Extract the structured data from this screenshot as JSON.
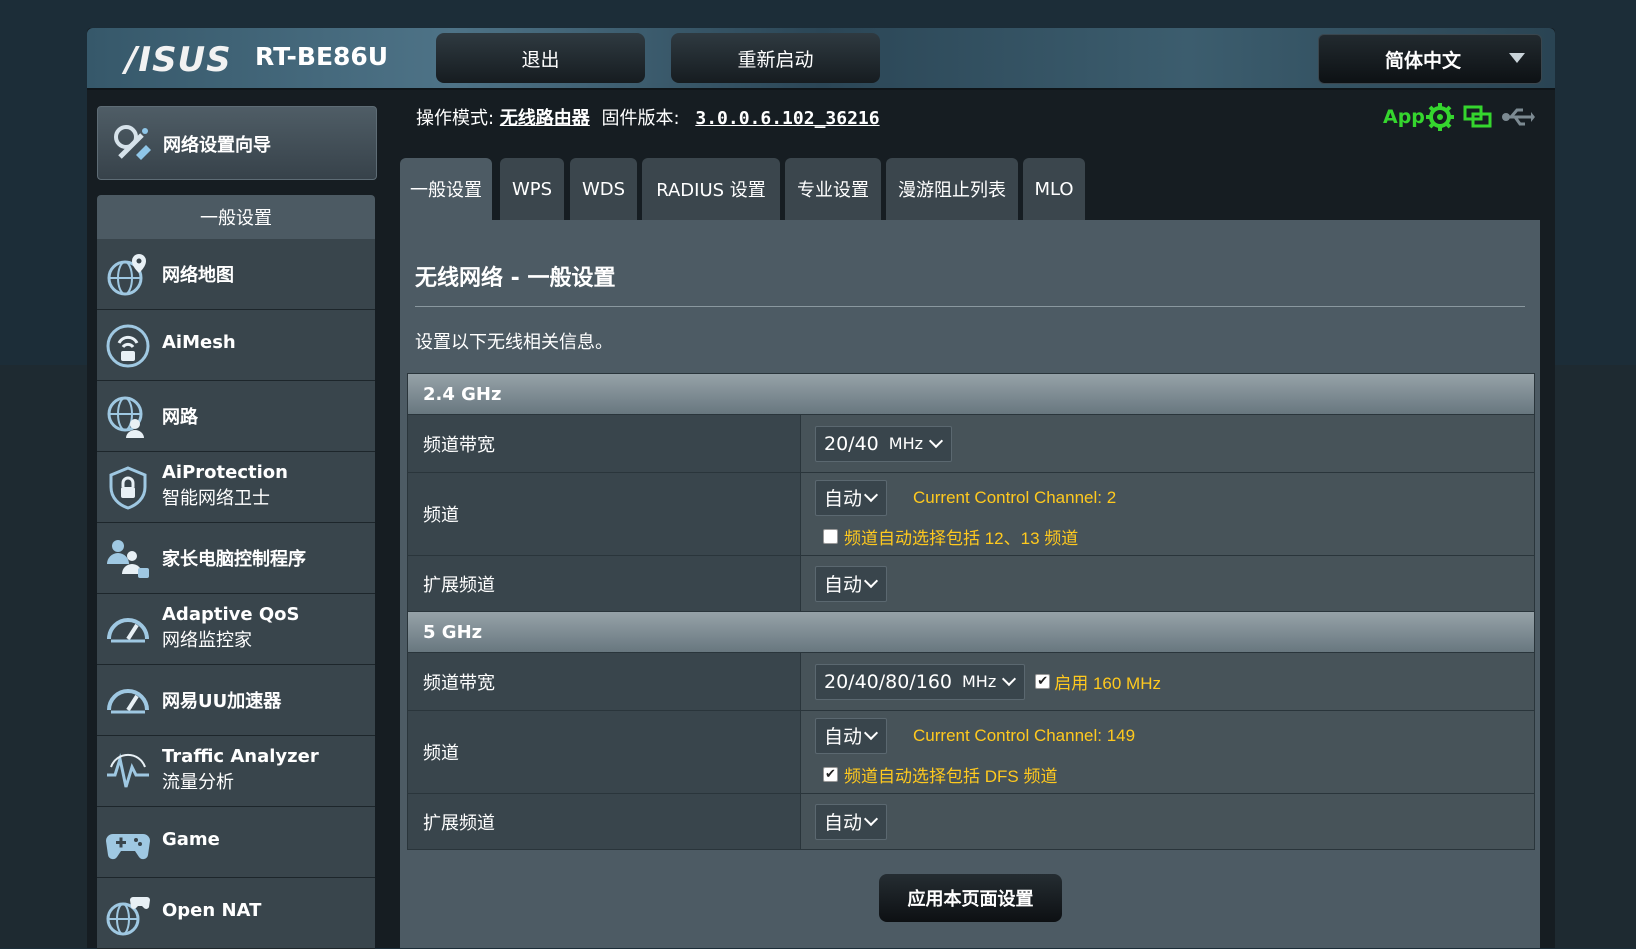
{
  "header": {
    "logo": "/ISUS",
    "model": "RT-BE86U",
    "logout_label": "退出",
    "reboot_label": "重新启动",
    "language": "简体中文"
  },
  "info": {
    "mode_label": "操作模式:",
    "mode_value": "无线路由器",
    "fw_label": "固件版本:",
    "fw_value": "3.0.0.6.102_36216",
    "app_label": "App"
  },
  "sidebar": {
    "wizard": "网络设置向导",
    "section": "一般设置",
    "items": [
      {
        "l1": "网络地图",
        "l2": "",
        "icon": "globe-pin-icon"
      },
      {
        "l1": "AiMesh",
        "l2": "",
        "icon": "aimesh-router-icon"
      },
      {
        "l1": "网路",
        "l2": "",
        "icon": "globe-users-icon"
      },
      {
        "l1": "AiProtection",
        "l2": "智能网络卫士",
        "icon": "shield-lock-icon"
      },
      {
        "l1": "家长电脑控制程序",
        "l2": "",
        "icon": "family-lock-icon"
      },
      {
        "l1": "Adaptive QoS",
        "l2": "网络监控家",
        "icon": "speedometer-icon"
      },
      {
        "l1": "网易UU加速器",
        "l2": "",
        "icon": "gauge-icon"
      },
      {
        "l1": "Traffic Analyzer",
        "l2": "流量分析",
        "icon": "pulse-icon"
      },
      {
        "l1": "Game",
        "l2": "",
        "icon": "gamepad-icon"
      },
      {
        "l1": "Open NAT",
        "l2": "",
        "icon": "nat-globe-icon"
      }
    ]
  },
  "tabs": [
    "一般设置",
    "WPS",
    "WDS",
    "RADIUS 设置",
    "专业设置",
    "漫游阻止列表",
    "MLO"
  ],
  "page": {
    "title": "无线网络 - 一般设置",
    "desc": "设置以下无线相关信息。",
    "apply_label": "应用本页面设置"
  },
  "bands": {
    "b24": {
      "title": "2.4 GHz",
      "bw_label": "频道带宽",
      "bw_value": "20/40",
      "bw_unit": "MHz",
      "ch_label": "频道",
      "ch_value": "自动",
      "ch_current": "Current Control Channel: 2",
      "ch_option": "频道自动选择包括 12、13 频道",
      "ch_option_checked": false,
      "ext_label": "扩展频道",
      "ext_value": "自动"
    },
    "b5": {
      "title": "5 GHz",
      "bw_label": "频道带宽",
      "bw_value": "20/40/80/160",
      "bw_unit": "MHz",
      "bw_option": "启用 160 MHz",
      "bw_option_checked": true,
      "ch_label": "频道",
      "ch_value": "自动",
      "ch_current": "Current Control Channel: 149",
      "ch_option": "频道自动选择包括 DFS 频道",
      "ch_option_checked": true,
      "ext_label": "扩展频道",
      "ext_value": "自动"
    }
  },
  "colors": {
    "accent_yellow": "#ffc91e",
    "status_green": "#35d62e",
    "panel": "#4d5b64"
  }
}
